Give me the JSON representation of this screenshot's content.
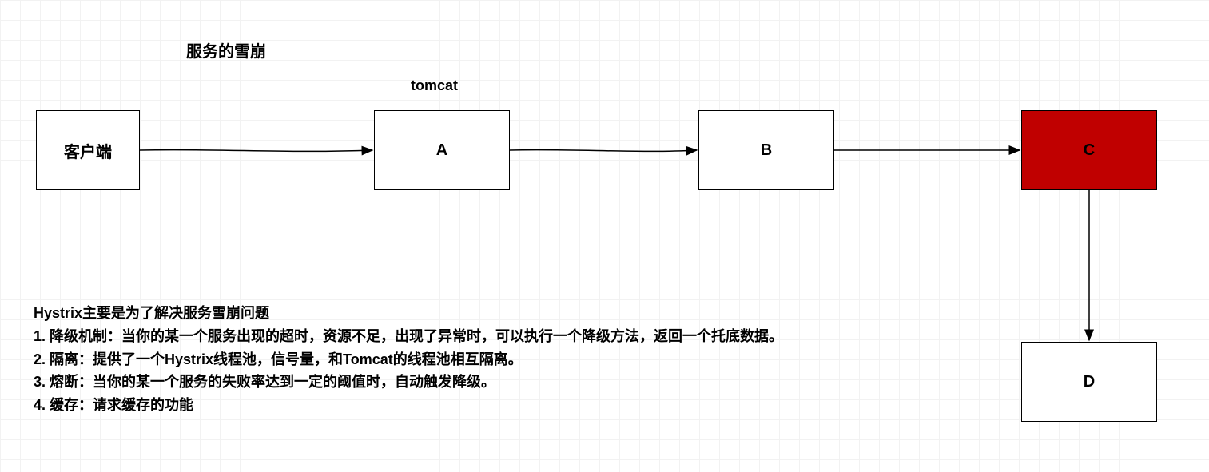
{
  "title": "服务的雪崩",
  "tomcat_label": "tomcat",
  "nodes": {
    "client": "客户端",
    "a": "A",
    "b": "B",
    "c": "C",
    "d": "D"
  },
  "colors": {
    "error_box": "#C00000"
  },
  "description": {
    "heading": "Hystrix主要是为了解决服务雪崩问题",
    "items": [
      "1. 降级机制：当你的某一个服务出现的超时，资源不足，出现了异常时，可以执行一个降级方法，返回一个托底数据。",
      "2. 隔离：提供了一个Hystrix线程池，信号量，和Tomcat的线程池相互隔离。",
      "3. 熔断：当你的某一个服务的失败率达到一定的阈值时，自动触发降级。",
      "4. 缓存：请求缓存的功能"
    ]
  }
}
